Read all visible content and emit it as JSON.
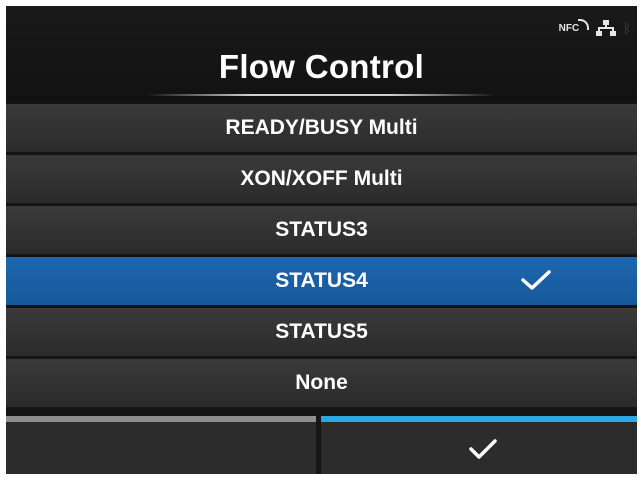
{
  "header": {
    "title": "Flow Control",
    "status_icons": [
      "nfc-icon",
      "network-icon",
      "bluetooth-icon"
    ],
    "nfc_label": "NFC"
  },
  "options": [
    {
      "label": "READY/BUSY Multi",
      "selected": false
    },
    {
      "label": "XON/XOFF Multi",
      "selected": false
    },
    {
      "label": "STATUS3",
      "selected": false
    },
    {
      "label": "STATUS4",
      "selected": true
    },
    {
      "label": "STATUS5",
      "selected": false
    },
    {
      "label": "None",
      "selected": false
    }
  ],
  "footer": {
    "left_button": "back",
    "right_button": "confirm-check-icon"
  },
  "colors": {
    "background": "#151515",
    "item": "#333333",
    "selected": "#1a5fa3",
    "accent": "#2aa8e8",
    "left_bar": "#8e8e8e"
  }
}
